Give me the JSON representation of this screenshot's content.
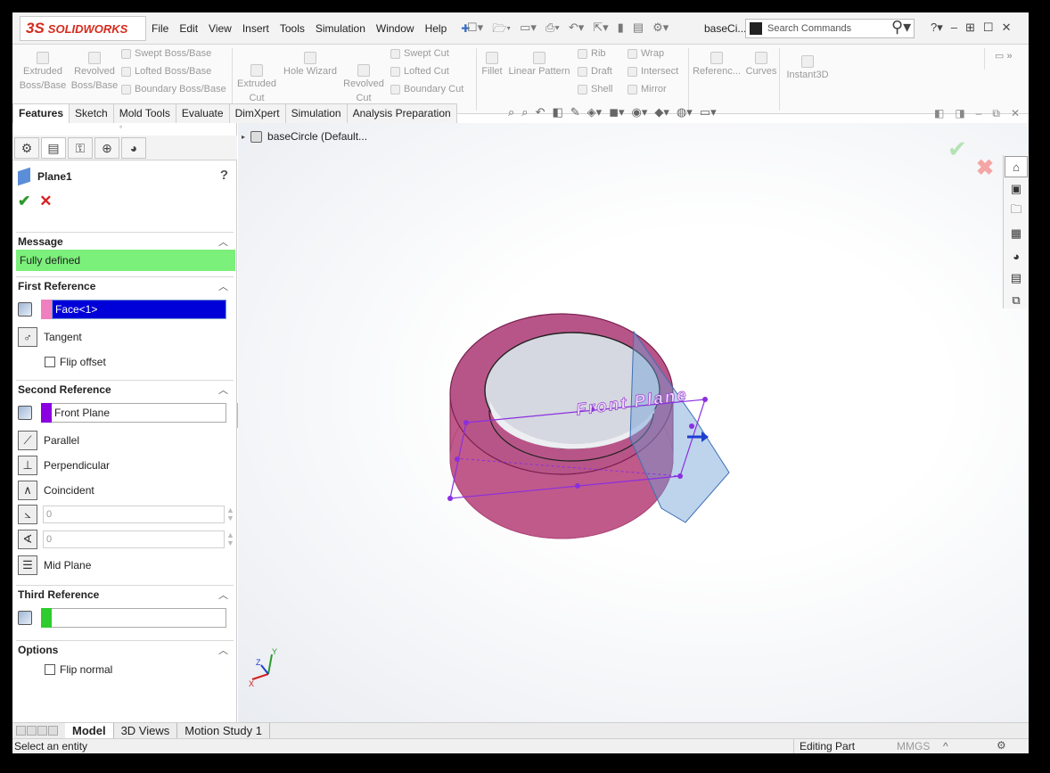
{
  "app": {
    "brand_ds": "3S",
    "brand_name": "SOLIDWORKS"
  },
  "menubar": {
    "menus": [
      "File",
      "Edit",
      "View",
      "Insert",
      "Tools",
      "Simulation",
      "Window",
      "Help"
    ],
    "doc_title": "baseCi...",
    "search_placeholder": "Search Commands"
  },
  "command_manager": {
    "extruded_boss": "Extruded Boss/Base",
    "revolved_boss": "Revolved Boss/Base",
    "swept_boss": "Swept Boss/Base",
    "lofted_boss": "Lofted Boss/Base",
    "boundary_boss": "Boundary Boss/Base",
    "extruded_cut": "Extruded Cut",
    "hole_wizard": "Hole Wizard",
    "revolved_cut": "Revolved Cut",
    "swept_cut": "Swept Cut",
    "lofted_cut": "Lofted Cut",
    "boundary_cut": "Boundary Cut",
    "fillet": "Fillet",
    "linear_pattern": "Linear Pattern",
    "rib": "Rib",
    "draft": "Draft",
    "shell": "Shell",
    "wrap": "Wrap",
    "intersect": "Intersect",
    "mirror": "Mirror",
    "reference": "Referenc...",
    "curves": "Curves",
    "instant3d": "Instant3D"
  },
  "tabs": [
    {
      "label": "Features",
      "active": true
    },
    {
      "label": "Sketch"
    },
    {
      "label": "Mold Tools"
    },
    {
      "label": "Evaluate"
    },
    {
      "label": "DimXpert"
    },
    {
      "label": "Simulation"
    },
    {
      "label": "Analysis Preparation"
    }
  ],
  "property_manager": {
    "title": "Plane1",
    "help": "?",
    "message_header": "Message",
    "message": "Fully defined",
    "first_ref": {
      "header": "First Reference",
      "value": "Face<1>",
      "swatch_color": "#f07fc0",
      "option_tangent": "Tangent",
      "flip_offset": "Flip offset"
    },
    "second_ref": {
      "header": "Second Reference",
      "value": "Front Plane",
      "swatch_color": "#8a00e0",
      "parallel": "Parallel",
      "perpendicular": "Perpendicular",
      "coincident": "Coincident",
      "distance": "0",
      "angle": "0",
      "mid_plane": "Mid Plane"
    },
    "third_ref": {
      "header": "Third Reference",
      "value": "",
      "swatch_color": "#2ecc2e"
    },
    "options": {
      "header": "Options",
      "flip_normal": "Flip normal"
    }
  },
  "graphics": {
    "tree_root": "baseCircle  (Default...",
    "plane_label": "Front Plane",
    "triad": {
      "x": "X",
      "y": "Y",
      "z": "Z"
    }
  },
  "bottom_tabs": [
    {
      "label": "Model",
      "active": true
    },
    {
      "label": "3D Views"
    },
    {
      "label": "Motion Study 1"
    }
  ],
  "status": {
    "prompt": "Select an entity",
    "mode": "Editing Part",
    "units": "MMGS",
    "caret": "^"
  },
  "colors": {
    "accent_blue": "#0000d8",
    "message_green": "#7bf07b",
    "brand_red": "#d52b1e",
    "body_pink": "#c05a8a"
  }
}
